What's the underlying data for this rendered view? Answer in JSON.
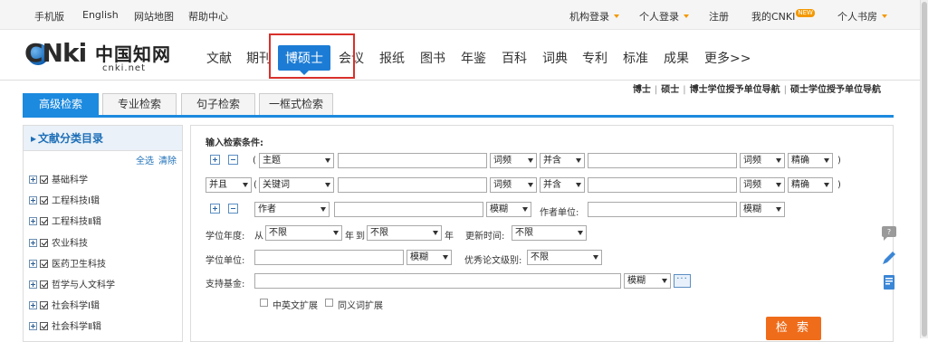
{
  "topbar": {
    "mobile": "手机版",
    "english": "English",
    "sitemap": "网站地图",
    "help": "帮助中心",
    "org_login": "机构登录",
    "personal_login": "个人登录",
    "register": "注册",
    "my_cnki": "我的CNKI",
    "new_badge": "NEW",
    "personal_library": "个人书房"
  },
  "logo": {
    "cnki": "CNki",
    "chinese": "中国知网",
    "domain": "cnki.net"
  },
  "nav": [
    {
      "label": "文献"
    },
    {
      "label": "期刊"
    },
    {
      "label": "博硕士",
      "active": true
    },
    {
      "label": "会议"
    },
    {
      "label": "报纸"
    },
    {
      "label": "图书"
    },
    {
      "label": "年鉴"
    },
    {
      "label": "百科"
    },
    {
      "label": "词典"
    },
    {
      "label": "专利"
    },
    {
      "label": "标准"
    },
    {
      "label": "成果"
    },
    {
      "label": "更多>>"
    }
  ],
  "degree_links": [
    "博士",
    "硕士",
    "博士学位授予单位导航",
    "硕士学位授予单位导航"
  ],
  "tabs": [
    "高级检索",
    "专业检索",
    "句子检索",
    "一框式检索"
  ],
  "sidebar": {
    "title": "文献分类目录",
    "select_all": "全选",
    "clear": "清除",
    "items": [
      "基础科学",
      "工程科技Ⅰ辑",
      "工程科技Ⅱ辑",
      "农业科技",
      "医药卫生科技",
      "哲学与人文科学",
      "社会科学Ⅰ辑",
      "社会科学Ⅱ辑"
    ]
  },
  "form": {
    "title": "输入检索条件:",
    "row1": {
      "open_paren": "(",
      "field": "主题",
      "freq1": "词频",
      "combine": "并含",
      "freq2": "词频",
      "match": "精确",
      "close_paren": ")"
    },
    "row2": {
      "logic": "并且",
      "open_paren": "(",
      "field": "关键词",
      "freq1": "词频",
      "combine": "并含",
      "freq2": "词频",
      "match": "精确",
      "close_paren": ")"
    },
    "row3": {
      "field": "作者",
      "match": "模糊",
      "org_label": "作者单位:",
      "org_match": "模糊"
    },
    "degree_year": {
      "label": "学位年度:",
      "from": "从",
      "from_val": "不限",
      "year1": "年",
      "to": "到",
      "to_val": "不限",
      "year2": "年",
      "update_label": "更新时间:",
      "update_val": "不限"
    },
    "degree_unit": {
      "label": "学位单位:",
      "match": "模糊",
      "excellent_label": "优秀论文级别:",
      "excellent_val": "不限"
    },
    "fund": {
      "label": "支持基金:",
      "match": "模糊",
      "dots": "···"
    },
    "options": {
      "cn_en": "中英文扩展",
      "synonym": "同义词扩展"
    },
    "search_button": "检 索"
  },
  "colors": {
    "accent": "#1c8adf",
    "search": "#ef6c1b",
    "highlight_box": "#d9302b"
  }
}
